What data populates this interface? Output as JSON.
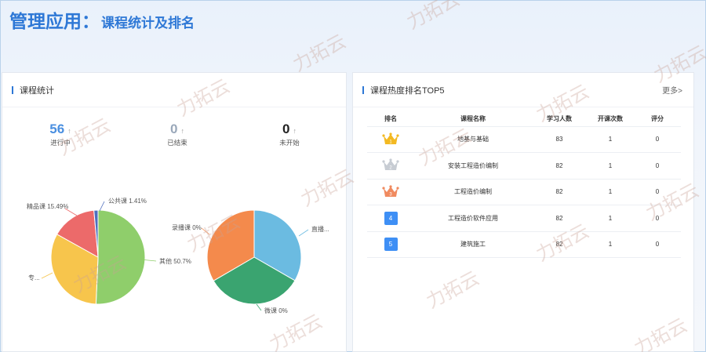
{
  "header": {
    "title": "管理应用：",
    "subtitle": "课程统计及排名"
  },
  "stats_panel": {
    "title": "课程统计",
    "stats": [
      {
        "value": "56",
        "arrow": "↑",
        "label": "进行中",
        "color": "#4a8fe0"
      },
      {
        "value": "0",
        "arrow": "↑",
        "label": "已结束",
        "color": "#9aa8ba"
      },
      {
        "value": "0",
        "arrow": "↑",
        "label": "未开始",
        "color": "#222222"
      }
    ]
  },
  "chart_data": [
    {
      "type": "pie",
      "slices": [
        {
          "label": "其他 50.7%",
          "value": 50.7,
          "color": "#8fce6b"
        },
        {
          "label": "专...",
          "value": 32.4,
          "color": "#f7c54c"
        },
        {
          "label": "精品课 15.49%",
          "value": 15.49,
          "color": "#ec6a6a"
        },
        {
          "label": "公共课 1.41%",
          "value": 1.41,
          "color": "#4d6fbe"
        }
      ]
    },
    {
      "type": "pie",
      "slices": [
        {
          "label": "直播...",
          "value": 33.3,
          "color": "#6bbbe1"
        },
        {
          "label": "微课 0%",
          "value": 33.3,
          "color": "#3aa470"
        },
        {
          "label": "录播课 0%",
          "value": 33.4,
          "color": "#f48a4c"
        }
      ]
    }
  ],
  "ranking_panel": {
    "title": "课程热度排名TOP5",
    "more": "更多>",
    "columns": [
      "排名",
      "课程名称",
      "学习人数",
      "开课次数",
      "评分"
    ],
    "rows": [
      {
        "rank": "1",
        "name": "地基与基础",
        "learners": "83",
        "sessions": "1",
        "score": "0",
        "badge": "gold-crown"
      },
      {
        "rank": "2",
        "name": "安装工程造价编制",
        "learners": "82",
        "sessions": "1",
        "score": "0",
        "badge": "silver-crown"
      },
      {
        "rank": "3",
        "name": "工程造价编制",
        "learners": "82",
        "sessions": "1",
        "score": "0",
        "badge": "bronze-crown"
      },
      {
        "rank": "4",
        "name": "工程造价软件应用",
        "learners": "82",
        "sessions": "1",
        "score": "0",
        "badge": "box"
      },
      {
        "rank": "5",
        "name": "建筑施工",
        "learners": "82",
        "sessions": "1",
        "score": "0",
        "badge": "box"
      }
    ]
  },
  "watermark": "力拓云"
}
